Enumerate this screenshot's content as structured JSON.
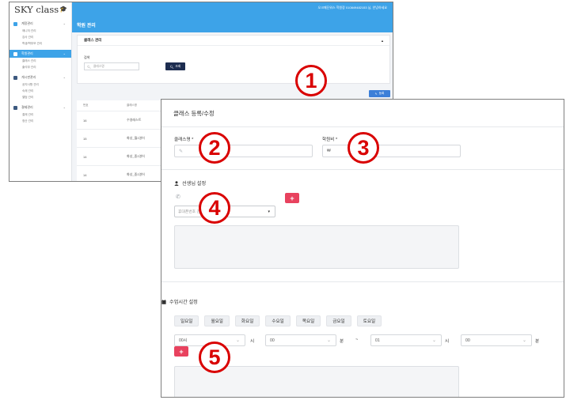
{
  "back_window": {
    "brand": "SKY class",
    "top_user_info": "오크매딘워스 학원장   010849482153 님, 안녕하세요",
    "page_title": "학원 관리",
    "sidebar": [
      {
        "label": "계정관리",
        "color": "#3da3e8",
        "active": false,
        "subs": [
          "매니저 관리",
          "강사 관리",
          "학생/학부모 관리"
        ]
      },
      {
        "label": "학원관리",
        "color": "#3da3e8",
        "active": true,
        "subs": [
          "클래스 관리",
          "출석부 관리"
        ]
      },
      {
        "label": "게시판관리",
        "color": "#3d5a80",
        "active": false,
        "subs": [
          "공지사항 관리",
          "숙제 관리",
          "앨범 관리"
        ]
      },
      {
        "label": "결제관리",
        "color": "#3d5a80",
        "active": false,
        "subs": [
          "결제 관리",
          "정산 관리"
        ]
      }
    ],
    "card_title": "클래스 관리",
    "search_label": "검색",
    "search_placeholder": "클래스명",
    "search_button": "조회",
    "register_button": "등록",
    "table": {
      "headers": [
        "번호",
        "클래스명"
      ],
      "rows": [
        [
          "16",
          "수영레스트"
        ],
        [
          "15",
          "화성_월1영어"
        ],
        [
          "14",
          "화성_중1영어"
        ],
        [
          "14",
          "화성_중1영어"
        ]
      ]
    }
  },
  "front_window": {
    "title": "클래스 등록/수정",
    "class_name_label": "클래스명 *",
    "fee_label": "학원비 *",
    "fee_prefix": "₩",
    "teacher_section": "선생님 설정",
    "teacher_select_placeholder": "휴대폰번호 검색",
    "schedule_section": "수업시간 설정",
    "days": [
      "일요일",
      "월요일",
      "화요일",
      "수요일",
      "목요일",
      "금요일",
      "토요일"
    ],
    "time": {
      "start_hour": "00시",
      "start_min": "00",
      "end_hour": "01",
      "end_min": "00",
      "hour_unit": "시",
      "min_unit": "분",
      "separator": "~"
    },
    "add_symbol": "+"
  },
  "annotations": [
    "1",
    "2",
    "3",
    "4",
    "5"
  ],
  "colors": {
    "primary": "#3da3e8",
    "navy": "#1d2d50",
    "accent_red": "#e8425e",
    "badge_red": "#d90000"
  }
}
